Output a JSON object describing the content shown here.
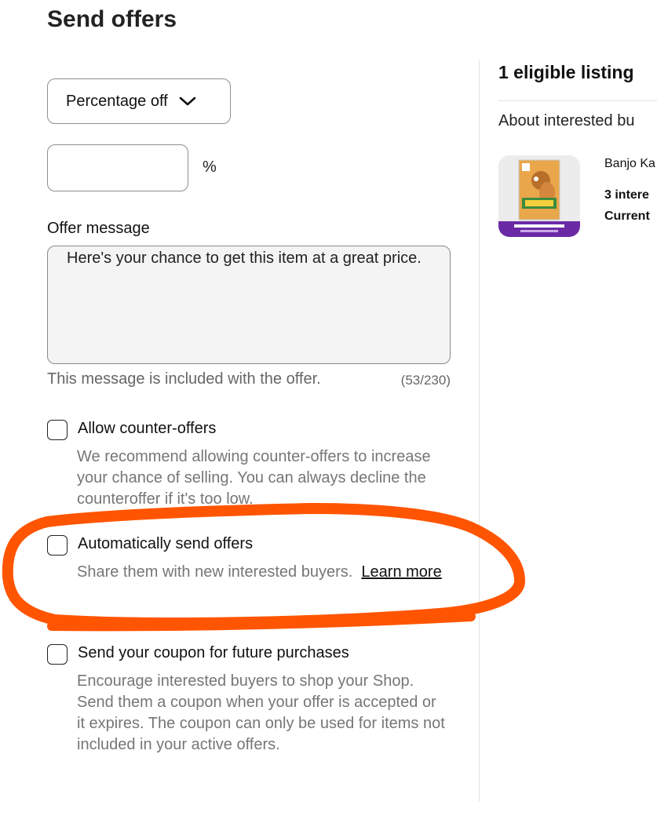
{
  "page": {
    "title": "Send offers"
  },
  "form": {
    "discount_type": "Percentage off",
    "percent_value": "",
    "percent_symbol": "%",
    "offer_message_label": "Offer message",
    "offer_message_value": "Here's your chance to get this item at a great price.",
    "helper_text": "This message is included with the offer.",
    "char_counter": "(53/230)"
  },
  "options": {
    "counter_offers": {
      "label": "Allow counter-offers",
      "description": "We recommend allowing counter-offers to increase your chance of selling. You can always decline the counteroffer if it's too low.",
      "checked": false
    },
    "auto_send": {
      "label": "Automatically send offers",
      "description": "Share them with new interested buyers.",
      "learn_more": "Learn more",
      "checked": false
    },
    "coupon": {
      "label": "Send your coupon for future purchases",
      "description": "Encourage interested buyers to shop your Shop. Send them a coupon when your offer is accepted or it expires. The coupon can only be used for items not included in your active offers.",
      "checked": false
    }
  },
  "sidebar": {
    "heading": "1 eligible listing",
    "subheading": "About interested bu",
    "listing": {
      "name": "Banjo Ka",
      "interested": "3 intere",
      "current": "Current"
    }
  },
  "colors": {
    "annotation": "#ff5500",
    "muted_text": "#767676",
    "border": "#8f8f8f"
  }
}
